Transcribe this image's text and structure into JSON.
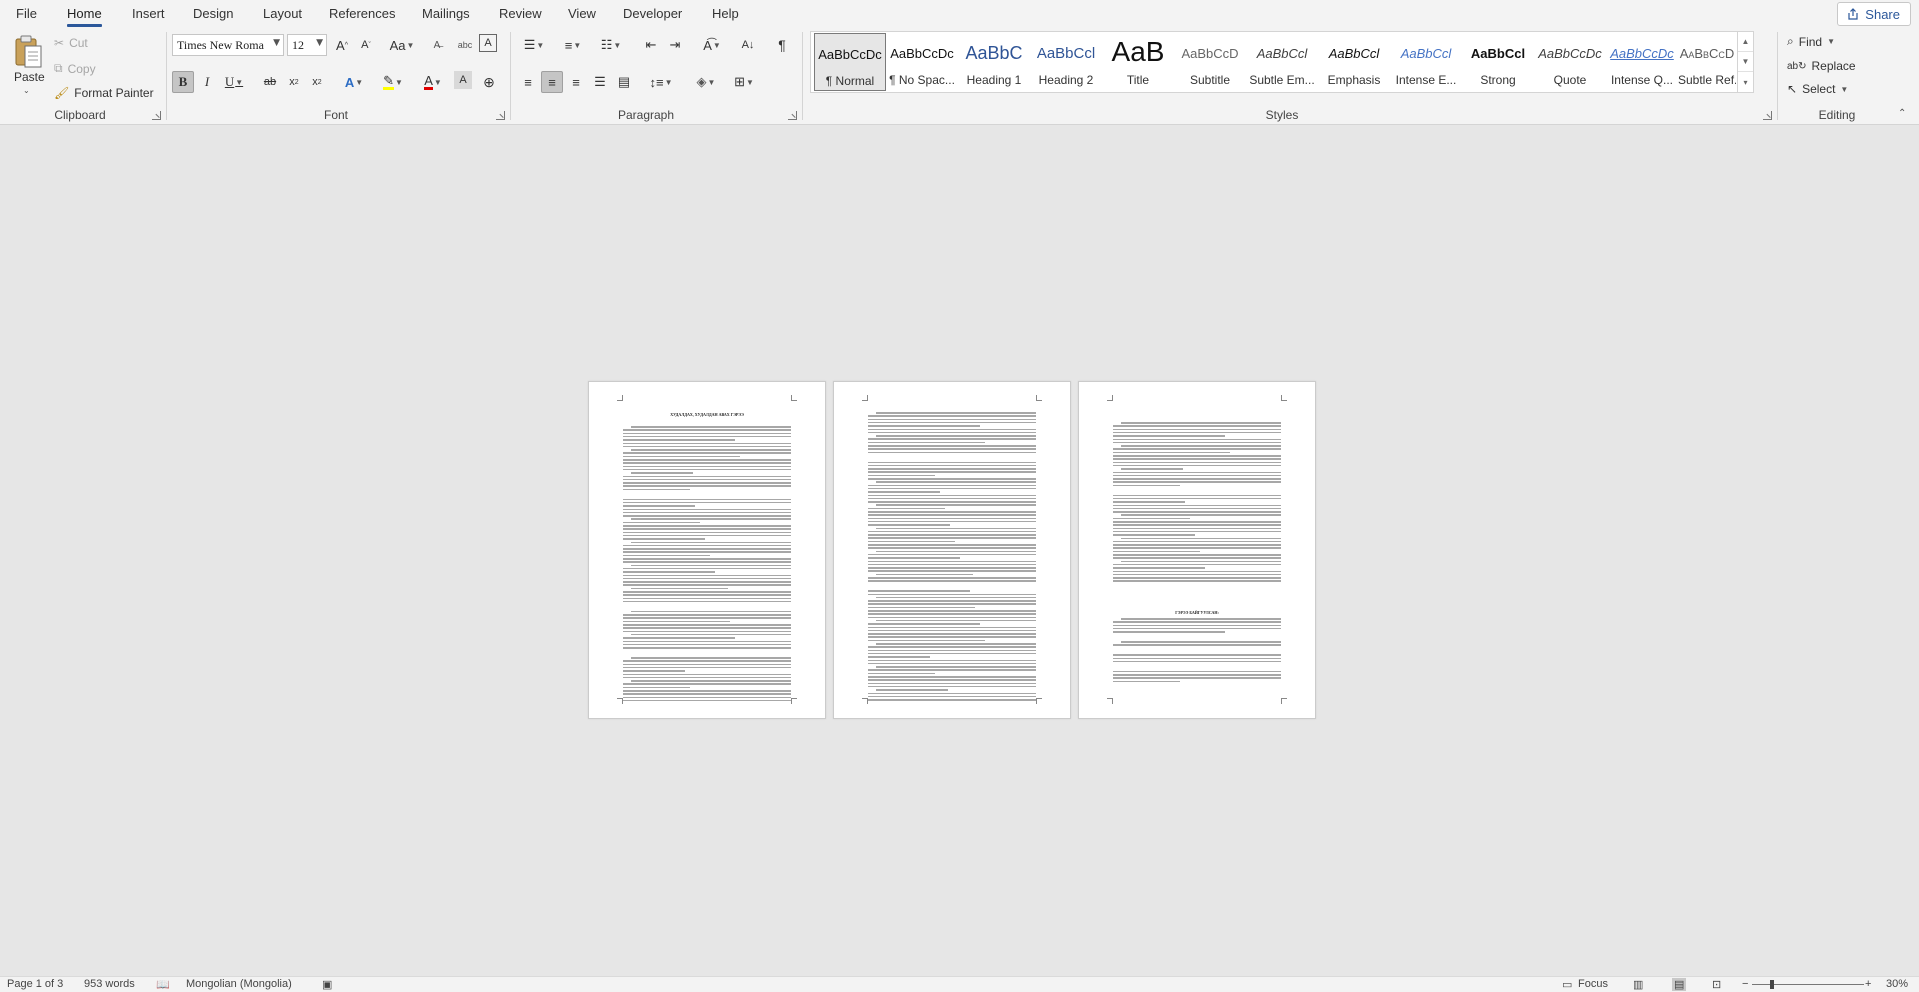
{
  "tabs": [
    "File",
    "Home",
    "Insert",
    "Design",
    "Layout",
    "References",
    "Mailings",
    "Review",
    "View",
    "Developer",
    "Help"
  ],
  "active_tab": "Home",
  "share_label": "Share",
  "clipboard": {
    "paste": "Paste",
    "cut": "Cut",
    "copy": "Copy",
    "format_painter": "Format Painter",
    "group_label": "Clipboard"
  },
  "font": {
    "name": "Times New Roma",
    "size": "12",
    "group_label": "Font"
  },
  "paragraph": {
    "group_label": "Paragraph"
  },
  "styles": {
    "group_label": "Styles",
    "items": [
      {
        "preview": "AaBbCcDc",
        "name": "¶ Normal",
        "selected": true
      },
      {
        "preview": "AaBbCcDc",
        "name": "¶ No Spac..."
      },
      {
        "preview": "AaBbC",
        "name": "Heading 1"
      },
      {
        "preview": "AaBbCcl",
        "name": "Heading 2"
      },
      {
        "preview": "AaB",
        "name": "Title"
      },
      {
        "preview": "AaBbCcD",
        "name": "Subtitle"
      },
      {
        "preview": "AaBbCcl",
        "name": "Subtle Em..."
      },
      {
        "preview": "AaBbCcl",
        "name": "Emphasis"
      },
      {
        "preview": "AaBbCcl",
        "name": "Intense E..."
      },
      {
        "preview": "AaBbCcl",
        "name": "Strong"
      },
      {
        "preview": "AaBbCcDc",
        "name": "Quote"
      },
      {
        "preview": "AaBbCcDc",
        "name": "Intense Q..."
      },
      {
        "preview": "AaBbCcD",
        "name": "Subtle Ref..."
      }
    ]
  },
  "editing": {
    "find": "Find",
    "replace": "Replace",
    "select": "Select",
    "group_label": "Editing"
  },
  "document": {
    "page1_title": "ХУДАЛДАХ, ХУДАЛДАН АВАХ ГЭРЭЭ",
    "page3_title": "ГЭРЭЭ БАЙГУУЛСАН:"
  },
  "status": {
    "page": "Page 1 of 3",
    "words": "953 words",
    "language": "Mongolian (Mongolia)",
    "focus": "Focus",
    "zoom": "30%"
  }
}
